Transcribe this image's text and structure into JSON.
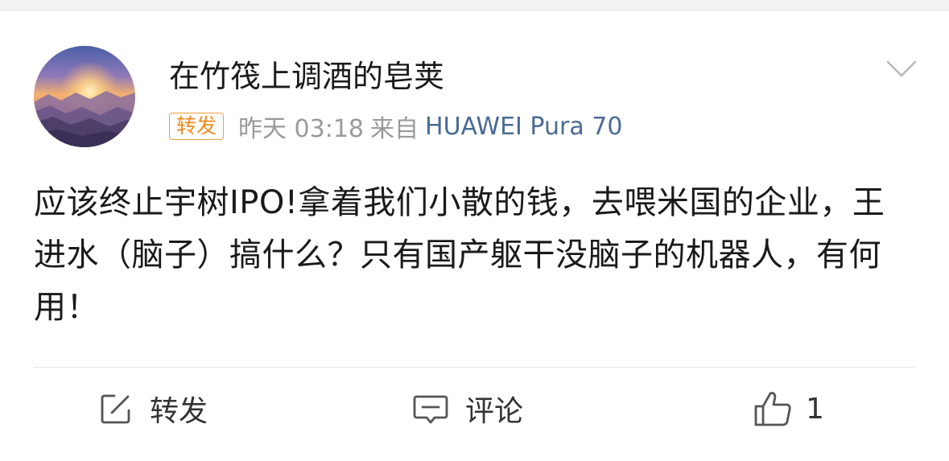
{
  "post": {
    "username": "在竹筏上调酒的皂荚",
    "badge": "转发",
    "time": "昨天 03:18",
    "source_prefix": "来自",
    "source_device": "HUAWEI Pura 70",
    "text": "应该终止宇树IPO!拿着我们小散的钱，去喂米国的企业，王进水（脑子）搞什么？只有国产躯干没脑子的机器人，有何用！"
  },
  "actions": {
    "repost_label": "转发",
    "comment_label": "评论",
    "like_count": "1"
  },
  "icons": {
    "more": "chevron-down-icon",
    "repost": "edit-share-icon",
    "comment": "comment-bubble-icon",
    "like": "thumbs-up-icon"
  },
  "colors": {
    "badge_orange": "#ee8a1c",
    "source_blue": "#4a6b94",
    "meta_gray": "#9a9a9a"
  }
}
